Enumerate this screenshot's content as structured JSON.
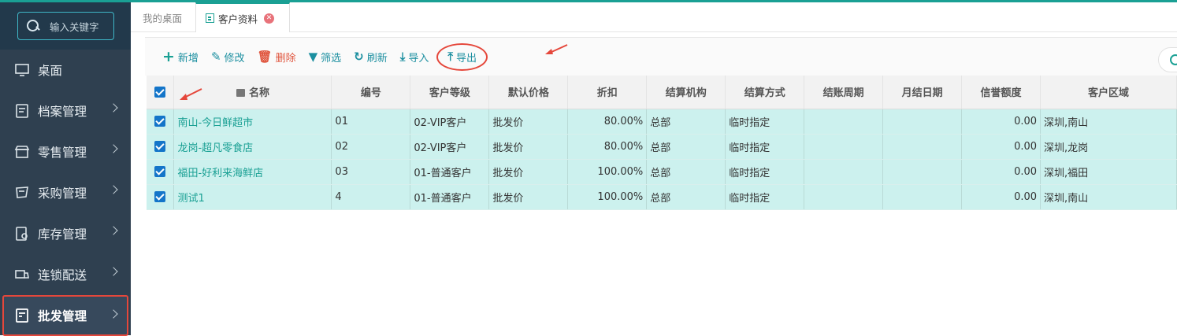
{
  "sidebar": {
    "search_placeholder": "输入关键字",
    "items": [
      {
        "label": "桌面",
        "icon": "monitor-icon",
        "has_arrow": false,
        "active": false
      },
      {
        "label": "档案管理",
        "icon": "archive-icon",
        "has_arrow": true,
        "active": false
      },
      {
        "label": "零售管理",
        "icon": "store-icon",
        "has_arrow": true,
        "active": false
      },
      {
        "label": "采购管理",
        "icon": "purchase-icon",
        "has_arrow": true,
        "active": false
      },
      {
        "label": "库存管理",
        "icon": "inventory-icon",
        "has_arrow": true,
        "active": false
      },
      {
        "label": "连锁配送",
        "icon": "delivery-icon",
        "has_arrow": true,
        "active": false
      },
      {
        "label": "批发管理",
        "icon": "wholesale-icon",
        "has_arrow": true,
        "active": true
      }
    ]
  },
  "tabs": {
    "desk": "我的桌面",
    "customer": "客户资料"
  },
  "toolbar": {
    "add": "新增",
    "edit": "修改",
    "delete": "删除",
    "filter": "筛选",
    "refresh": "刷新",
    "import": "导入",
    "export": "导出"
  },
  "table": {
    "headers": [
      "名称",
      "编号",
      "客户等级",
      "默认价格",
      "折扣",
      "结算机构",
      "结算方式",
      "结账周期",
      "月结日期",
      "信誉额度",
      "客户区域"
    ],
    "rows": [
      {
        "name": "南山-今日鲜超市",
        "code": "01",
        "level": "02-VIP客户",
        "price": "批发价",
        "discount": "80.00%",
        "org": "总部",
        "method": "临时指定",
        "cycle": "",
        "month_day": "",
        "credit": "0.00",
        "region": "深圳,南山"
      },
      {
        "name": "龙岗-超凡零食店",
        "code": "02",
        "level": "02-VIP客户",
        "price": "批发价",
        "discount": "80.00%",
        "org": "总部",
        "method": "临时指定",
        "cycle": "",
        "month_day": "",
        "credit": "0.00",
        "region": "深圳,龙岗"
      },
      {
        "name": "福田-好利来海鲜店",
        "code": "03",
        "level": "01-普通客户",
        "price": "批发价",
        "discount": "100.00%",
        "org": "总部",
        "method": "临时指定",
        "cycle": "",
        "month_day": "",
        "credit": "0.00",
        "region": "深圳,福田"
      },
      {
        "name": "测试1",
        "code": "4",
        "level": "01-普通客户",
        "price": "批发价",
        "discount": "100.00%",
        "org": "总部",
        "method": "临时指定",
        "cycle": "",
        "month_day": "",
        "credit": "0.00",
        "region": "深圳,南山"
      }
    ]
  },
  "colors": {
    "accent": "#1aa094",
    "sidebar_bg": "#2f4050",
    "highlight_red": "#e5473b",
    "row_bg": "#ccf1ee"
  }
}
